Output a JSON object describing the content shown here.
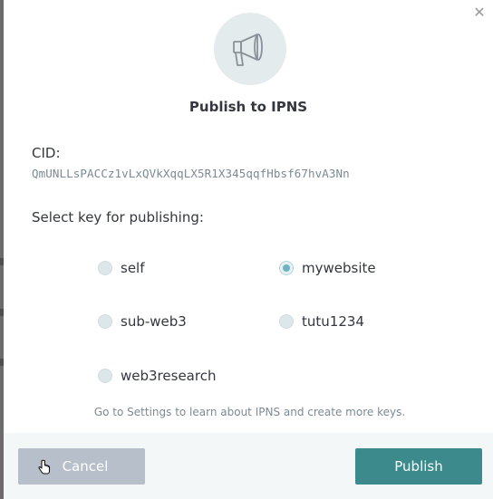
{
  "dialog": {
    "title": "Publish to IPNS",
    "close_icon": "close-icon",
    "hero_icon": "megaphone-icon"
  },
  "cid": {
    "label": "CID:",
    "value": "QmUNLLsPACCz1vLxQVkXqqLX5R1X345qqfHbsf67hvA3Nn"
  },
  "keys": {
    "label": "Select key for publishing:",
    "options": [
      {
        "label": "self",
        "checked": false
      },
      {
        "label": "mywebsite",
        "checked": true
      },
      {
        "label": "sub-web3",
        "checked": false
      },
      {
        "label": "tutu1234",
        "checked": false
      },
      {
        "label": "web3research",
        "checked": false
      }
    ],
    "hint": "Go to Settings to learn about IPNS and create more keys."
  },
  "footer": {
    "cancel_label": "Cancel",
    "publish_label": "Publish"
  },
  "colors": {
    "accent": "#3d8a8c",
    "cancel": "#b7bfca",
    "radio_dot": "#6fb3c0"
  }
}
